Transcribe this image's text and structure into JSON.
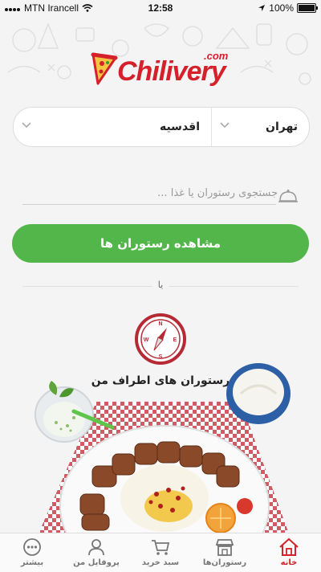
{
  "status_bar": {
    "carrier": "MTN Irancell",
    "time": "12:58",
    "battery": "100%"
  },
  "brand": {
    "name": "Chilivery",
    "suffix": ".com"
  },
  "location": {
    "city": "تهران",
    "area": "اقدسیه"
  },
  "search": {
    "placeholder": "جستجوی رستوران یا غذا ..."
  },
  "cta": {
    "label": "مشاهده رستوران ها"
  },
  "divider": {
    "or_label": "یا"
  },
  "nearby": {
    "label": "رستوران های اطراف من"
  },
  "tabs": [
    {
      "label": "بیشتر",
      "icon": "more-icon"
    },
    {
      "label": "پروفایل من",
      "icon": "user-icon"
    },
    {
      "label": "سبد خرید",
      "icon": "cart-icon"
    },
    {
      "label": "رستوران‌ها",
      "icon": "store-icon"
    },
    {
      "label": "خانه",
      "icon": "home-icon",
      "active": true
    }
  ],
  "colors": {
    "brand_red": "#d4212b",
    "cta_green": "#53b64a"
  }
}
